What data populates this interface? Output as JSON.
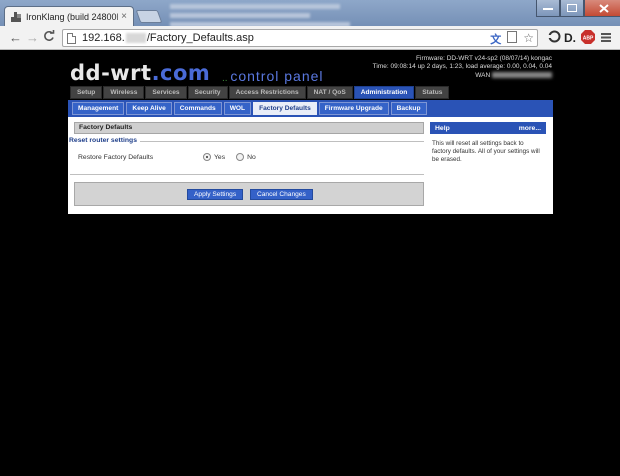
{
  "browser": {
    "tab_title": "IronKlang (build 24800M)",
    "tab_close": "×",
    "back_glyph": "←",
    "forward_glyph": "→",
    "reload_glyph": "C",
    "url_prefix": "192.168.",
    "url_suffix": "/Factory_Defaults.asp",
    "extensions": [
      "translate-icon",
      "page-icon",
      "star-icon",
      "disconnect-icon",
      "adblock-icon",
      "menu-icon"
    ],
    "adblock_label": "ABP"
  },
  "header": {
    "logo": "dd-wrt",
    "logo_tld": ".com",
    "subtitle": "control panel",
    "firmware": "Firmware: DD-WRT v24-sp2 (08/07/14) kongac",
    "time": "Time: 09:08:14 up 2 days, 1:23, load average: 0.00, 0.04, 0.04",
    "wan_label": "WAN"
  },
  "main_tabs": [
    {
      "label": "Setup",
      "active": false
    },
    {
      "label": "Wireless",
      "active": false
    },
    {
      "label": "Services",
      "active": false
    },
    {
      "label": "Security",
      "active": false
    },
    {
      "label": "Access Restrictions",
      "active": false
    },
    {
      "label": "NAT / QoS",
      "active": false
    },
    {
      "label": "Administration",
      "active": true
    },
    {
      "label": "Status",
      "active": false
    }
  ],
  "sub_tabs": [
    {
      "label": "Management",
      "active": false
    },
    {
      "label": "Keep Alive",
      "active": false
    },
    {
      "label": "Commands",
      "active": false
    },
    {
      "label": "WOL",
      "active": false
    },
    {
      "label": "Factory Defaults",
      "active": true
    },
    {
      "label": "Firmware Upgrade",
      "active": false
    },
    {
      "label": "Backup",
      "active": false
    }
  ],
  "section": {
    "title": "Factory Defaults",
    "legend": "Reset router settings",
    "field_label": "Restore Factory Defaults",
    "options": [
      {
        "label": "Yes",
        "checked": true
      },
      {
        "label": "No",
        "checked": false
      }
    ]
  },
  "buttons": {
    "apply": "Apply Settings",
    "cancel": "Cancel Changes"
  },
  "help": {
    "title": "Help",
    "more": "more...",
    "text": "This will reset all settings back to factory defaults. All of your settings will be erased."
  }
}
